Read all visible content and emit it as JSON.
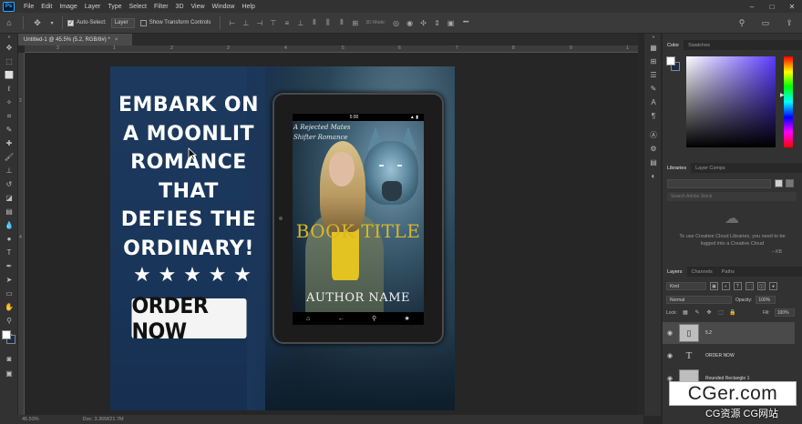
{
  "app": {
    "logo": "Ps",
    "menus": [
      "File",
      "Edit",
      "Image",
      "Layer",
      "Type",
      "Select",
      "Filter",
      "3D",
      "View",
      "Window",
      "Help"
    ],
    "window_controls": [
      "–",
      "□",
      "✕"
    ]
  },
  "options_bar": {
    "auto_select_label": "Auto-Select:",
    "auto_select_target": "Layer",
    "show_transform_label": "Show Transform Controls",
    "mode_3d_label": "3D Mode:",
    "more_label": "•••"
  },
  "document": {
    "tab_title": "Untitled-1 @ 45.5% (5.2, RGB/8#) *",
    "close_glyph": "×",
    "ruler_ticks": [
      "3",
      "1",
      "2",
      "3",
      "4",
      "5",
      "6",
      "7",
      "8",
      "9",
      "1",
      "2",
      "4"
    ]
  },
  "artwork": {
    "headline_lines": [
      "EMBARK ON",
      "A MOONLIT",
      "ROMANCE",
      "THAT",
      "DEFIES THE",
      "ORDINARY!"
    ],
    "stars": [
      "★",
      "★",
      "★",
      "★",
      "★"
    ],
    "order_button": "ORDER NOW",
    "tablet": {
      "status_left": "",
      "status_time": "5:00",
      "status_right": "▲ ▮",
      "tagline_line1": "A Rejected Mates",
      "tagline_line2": "Shifter Romance",
      "book_title": "BOOK TITLE",
      "author_name": "AUTHOR NAME",
      "nav_icons": [
        "⌂",
        "←",
        "⚲",
        "★"
      ]
    }
  },
  "panels": {
    "color_tabs": [
      "Color",
      "Swatches"
    ],
    "color_fg": "#ffffff",
    "color_bg": "#1b2b44",
    "library_tabs": [
      "Libraries",
      "Layer Comps"
    ],
    "library_search_placeholder": "Search Adobe Stock",
    "library_message": "To use Creative Cloud Libraries, you need to be logged into a Creative Cloud",
    "library_kb": "– KB",
    "layers_tabs": [
      "Layers",
      "Channels",
      "Paths"
    ],
    "layers_kind": "Kind",
    "blend_mode": "Normal",
    "opacity_label": "Opacity:",
    "opacity_value": "100%",
    "lock_label": "Lock:",
    "fill_label": "Fill:",
    "fill_value": "100%",
    "layers": [
      {
        "name": "5.2",
        "type": "smart",
        "selected": true
      },
      {
        "name": "ORDER NOW",
        "type": "text",
        "selected": false
      },
      {
        "name": "Rounded Rectangle 1",
        "type": "shape",
        "selected": false
      }
    ]
  },
  "status": {
    "zoom": "45.53%",
    "doc_size": "Doc: 3.36M/21.7M"
  },
  "watermark": {
    "main": "CGer.com",
    "sub": "CG资源 CG网站"
  }
}
